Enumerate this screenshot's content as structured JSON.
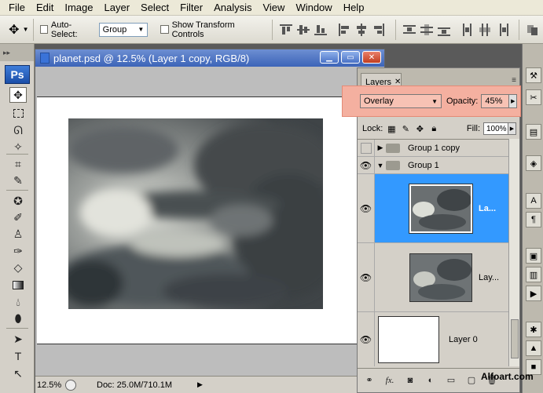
{
  "menu": [
    "File",
    "Edit",
    "Image",
    "Layer",
    "Select",
    "Filter",
    "Analysis",
    "View",
    "Window",
    "Help"
  ],
  "options": {
    "auto_select_label": "Auto-Select:",
    "auto_select_value": "Group",
    "transform_label": "Show Transform Controls"
  },
  "tools": {
    "logo": "Ps"
  },
  "document": {
    "title": "planet.psd @ 12.5% (Layer 1 copy, RGB/8)",
    "zoom": "12.5%",
    "doc_size": "Doc: 25.0M/710.1M"
  },
  "layers": {
    "tab_label": "Layers",
    "blend_mode": "Overlay",
    "opacity_label": "Opacity:",
    "opacity_value": "45%",
    "lock_label": "Lock:",
    "fill_label": "Fill:",
    "fill_value": "100%",
    "items": [
      {
        "name": "Group 1 copy"
      },
      {
        "name": "Group 1"
      },
      {
        "name": "La..."
      },
      {
        "name": "Lay..."
      },
      {
        "name": "Layer 0"
      }
    ]
  },
  "watermark": "Alfoart.com"
}
